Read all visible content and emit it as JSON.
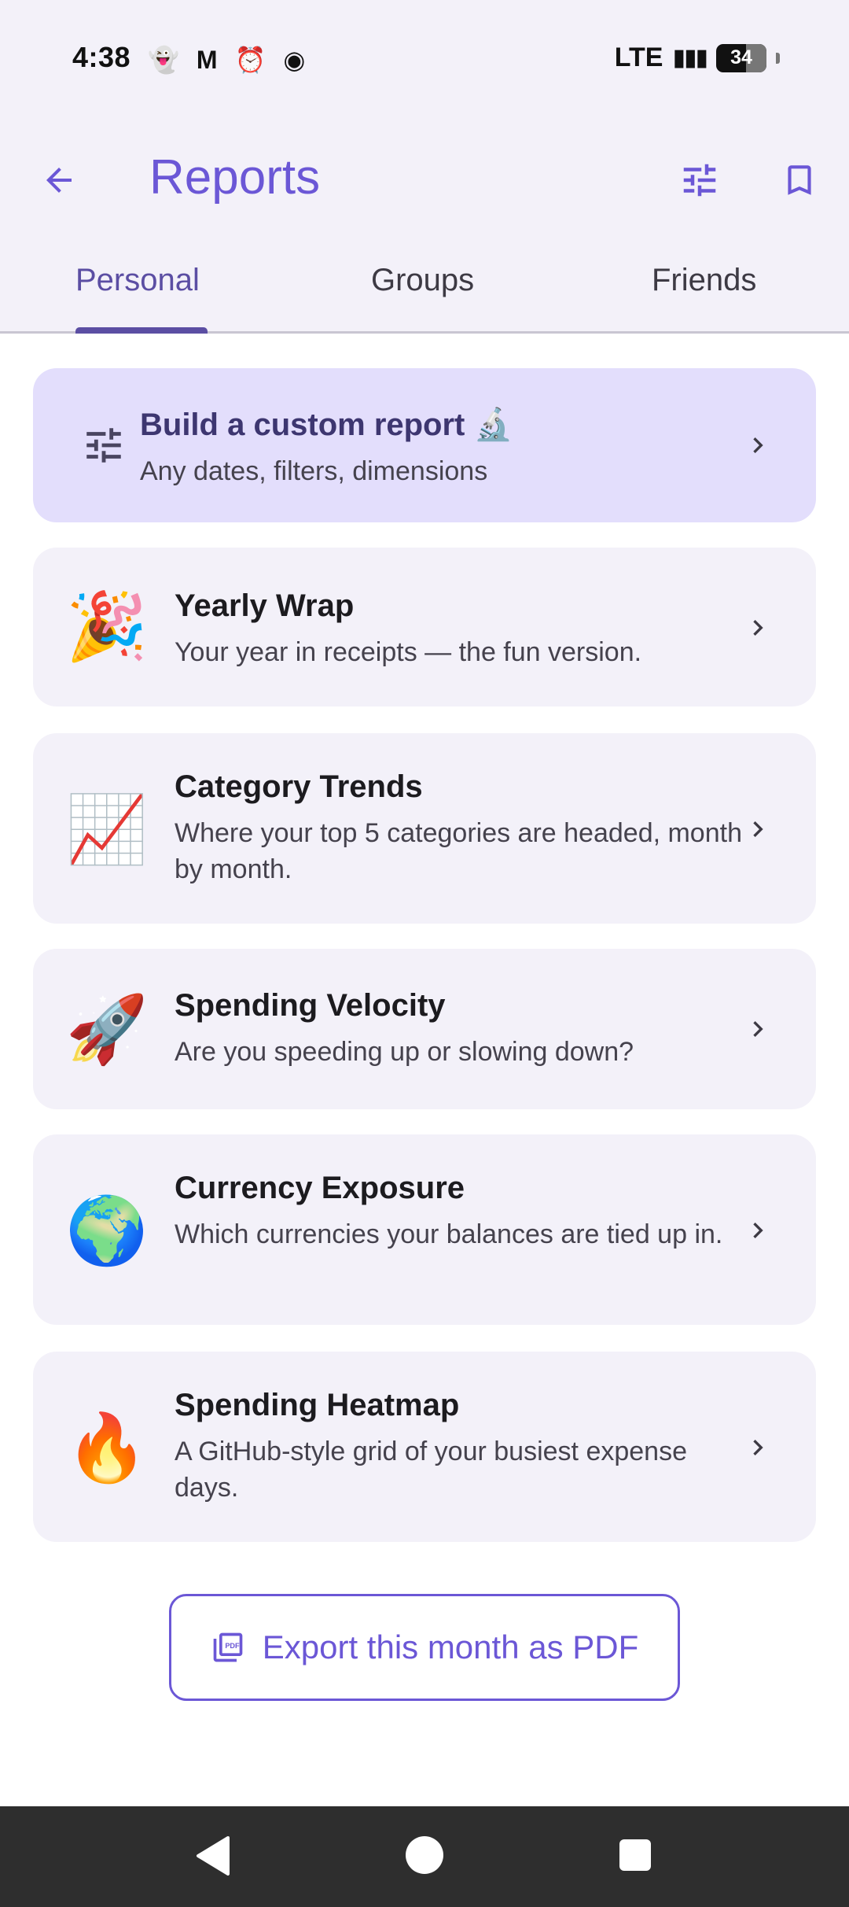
{
  "status_bar": {
    "time": "4:38",
    "notification_icons": [
      "snapchat-icon",
      "gmail-icon",
      "alarm-icon",
      "record-icon"
    ],
    "network": "LTE",
    "battery": "34"
  },
  "app_bar": {
    "title": "Reports",
    "back_icon": "arrow-left-icon",
    "filter_icon": "tune-icon",
    "bookmark_icon": "bookmark-icon"
  },
  "tabs": [
    {
      "label": "Personal",
      "active": true
    },
    {
      "label": "Groups",
      "active": false
    },
    {
      "label": "Friends",
      "active": false
    }
  ],
  "custom_report": {
    "title": "Build a custom report 🔬",
    "subtitle": "Any dates, filters, dimensions",
    "icon": "tune-icon"
  },
  "reports": [
    {
      "emoji": "🎉",
      "title": "Yearly Wrap",
      "subtitle": "Your year in receipts — the fun version."
    },
    {
      "emoji": "📈",
      "title": "Category Trends",
      "subtitle": "Where your top 5 categories are headed, month by month."
    },
    {
      "emoji": "🚀",
      "title": "Spending Velocity",
      "subtitle": "Are you speeding up or slowing down?"
    },
    {
      "emoji": "🌍",
      "title": "Currency Exposure",
      "subtitle": "Which currencies your balances are tied up in."
    },
    {
      "emoji": "🔥",
      "title": "Spending Heatmap",
      "subtitle": "A GitHub-style grid of your busiest expense days."
    }
  ],
  "export": {
    "label": "Export this month as PDF",
    "icon": "pdf-icon"
  },
  "colors": {
    "accent": "#6b57d6",
    "tab_active": "#5b4ea3",
    "custom_card_bg": "#e3defc",
    "card_bg": "#f3f1f9"
  }
}
